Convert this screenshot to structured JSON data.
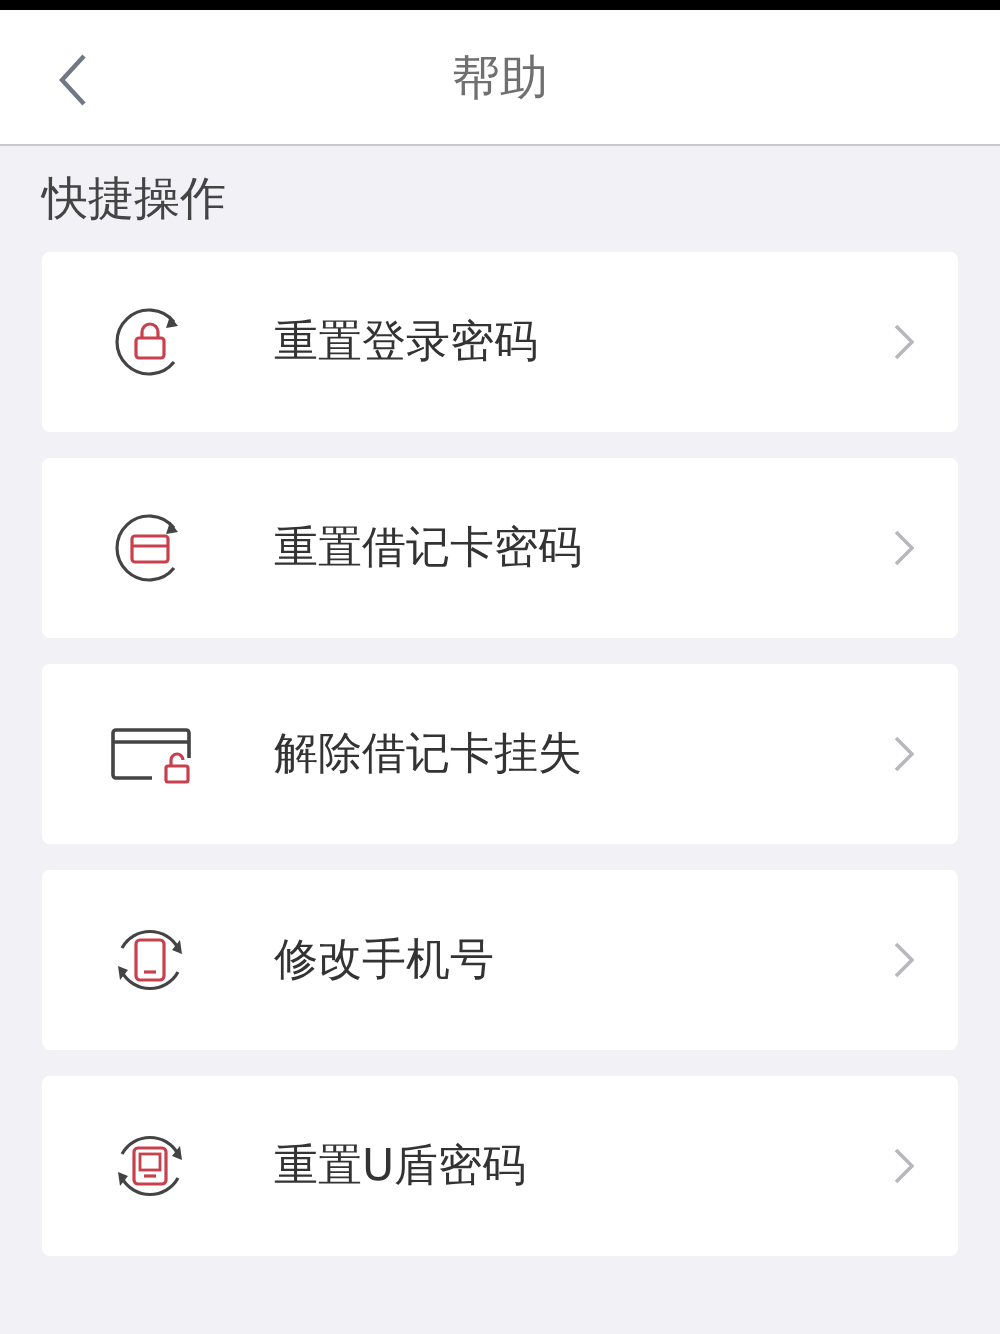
{
  "header": {
    "title": "帮助"
  },
  "section": {
    "title": "快捷操作"
  },
  "items": [
    {
      "kind": "lock",
      "label": "重置登录密码"
    },
    {
      "kind": "card",
      "label": "重置借记卡密码"
    },
    {
      "kind": "unlock",
      "label": "解除借记卡挂失"
    },
    {
      "kind": "phone",
      "label": "修改手机号"
    },
    {
      "kind": "token",
      "label": "重置U盾密码"
    }
  ]
}
